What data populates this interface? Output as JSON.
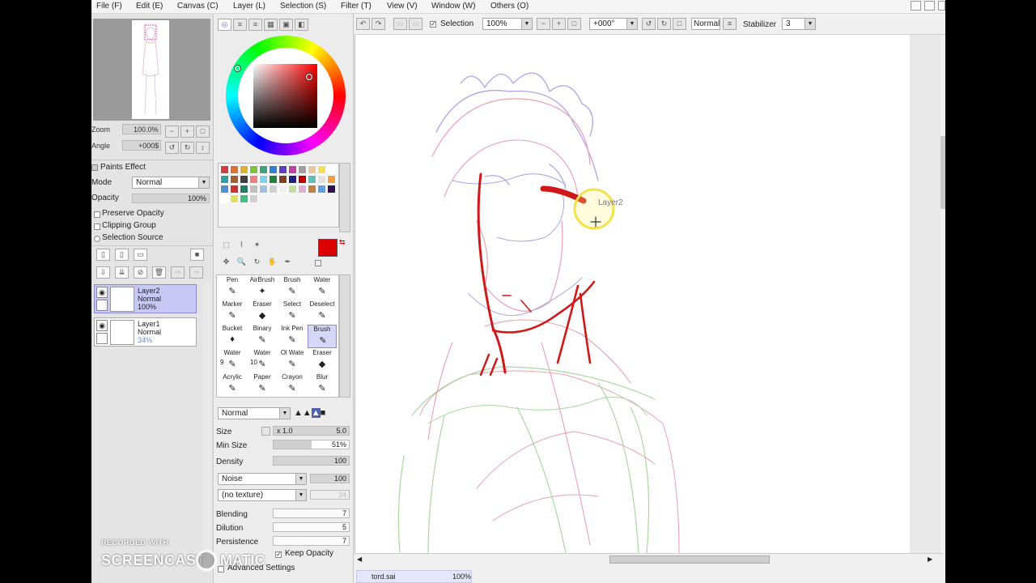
{
  "menubar": {
    "items": [
      "File (F)",
      "Edit (E)",
      "Canvas (C)",
      "Layer (L)",
      "Selection (S)",
      "Filter (T)",
      "View (V)",
      "Window (W)",
      "Others (O)"
    ]
  },
  "navigator": {
    "zoom_label": "Zoom",
    "zoom_value": "100.0%",
    "angle_label": "Angle",
    "angle_value": "+000$"
  },
  "layer_panel": {
    "paints_effect_label": "Paints Effect",
    "mode_label": "Mode",
    "mode_value": "Normal",
    "opacity_label": "Opacity",
    "opacity_value": "100%",
    "preserve_opacity_label": "Preserve Opacity",
    "clipping_group_label": "Clipping Group",
    "selection_source_label": "Selection Source",
    "layers": [
      {
        "name": "Layer2",
        "mode": "Normal",
        "opacity": "100%",
        "selected": true
      },
      {
        "name": "Layer1",
        "mode": "Normal",
        "opacity": "34%",
        "selected": false
      }
    ]
  },
  "colors": {
    "primary_color": "#dd0000",
    "secondary_color": "#ffffff",
    "palette": [
      "#d04040",
      "#e07030",
      "#e0b030",
      "#80c040",
      "#40a080",
      "#3080d0",
      "#6040c0",
      "#c040a0",
      "#a0a0a0",
      "#e8c8a0",
      "#f0e060",
      "#ffffff",
      "#30a0a0",
      "#a06030",
      "#404040",
      "#f08080",
      "#80d0f0",
      "#208040",
      "#804020",
      "#202080",
      "#c00000",
      "#60c0c0",
      "#e0e0e0",
      "#f0a040",
      "#5090d0",
      "#d03030",
      "#208060",
      "#c0c0c0",
      "#a0c0e0",
      "#d0d0d0",
      "#f0f0f0",
      "#c0e0a0",
      "#e0b0d0",
      "#c08040",
      "#60a0e0",
      "#301050",
      "#ffffff",
      "#e0e060",
      "#40c080",
      "#d0d0d0"
    ]
  },
  "tools": {
    "items": [
      {
        "label": "Pen",
        "glyph": "✎",
        "num": ""
      },
      {
        "label": "AirBrush",
        "glyph": "✦",
        "num": ""
      },
      {
        "label": "Brush",
        "glyph": "✎",
        "num": ""
      },
      {
        "label": "Water",
        "glyph": "✎",
        "num": ""
      },
      {
        "label": "Marker",
        "glyph": "✎",
        "num": ""
      },
      {
        "label": "Eraser",
        "glyph": "◆",
        "num": ""
      },
      {
        "label": "Select",
        "glyph": "✎",
        "num": ""
      },
      {
        "label": "Deselect",
        "glyph": "✎",
        "num": ""
      },
      {
        "label": "Bucket",
        "glyph": "♦",
        "num": ""
      },
      {
        "label": "Binary",
        "glyph": "✎",
        "num": ""
      },
      {
        "label": "Ink Pen",
        "glyph": "✎",
        "num": ""
      },
      {
        "label": "Brush",
        "glyph": "✎",
        "num": ""
      },
      {
        "label": "Water",
        "glyph": "✎",
        "num": "9"
      },
      {
        "label": "Water",
        "glyph": "✎",
        "num": "10"
      },
      {
        "label": "Ol Wate",
        "glyph": "✎",
        "num": ""
      },
      {
        "label": "Eraser",
        "glyph": "◆",
        "num": ""
      },
      {
        "label": "Acrylic",
        "glyph": "✎",
        "num": ""
      },
      {
        "label": "Paper",
        "glyph": "✎",
        "num": ""
      },
      {
        "label": "Crayon",
        "glyph": "✎",
        "num": ""
      },
      {
        "label": "Blur",
        "glyph": "✎",
        "num": ""
      }
    ],
    "selected_index": 11
  },
  "brush_settings": {
    "blend_mode": "Normal",
    "size_label": "Size",
    "size_multiplier": "x 1.0",
    "size_value": "5.0",
    "min_size_label": "Min Size",
    "min_size_value": "51%",
    "min_size_fraction": 0.51,
    "density_label": "Density",
    "density_value": "100",
    "noise_label": "Noise",
    "noise_value": "100",
    "texture_label": "(no texture)",
    "texture_value": "34",
    "blending_label": "Blending",
    "blending_value": "7",
    "dilution_label": "Dilution",
    "dilution_value": "5",
    "persistence_label": "Persistence",
    "persistence_value": "7",
    "keep_opacity_label": "Keep Opacity",
    "advanced_settings_label": "Advanced Settings"
  },
  "toolbar": {
    "selection_label": "Selection",
    "zoom_value": "100%",
    "rotation_value": "+000°",
    "blend_mode": "Normal",
    "stabilizer_label": "Stabilizer",
    "stabilizer_value": "3"
  },
  "canvas": {
    "cursor_layer_label": "Layer2"
  },
  "statusbar": {
    "doc_name": "tord.sai",
    "doc_zoom": "100%"
  },
  "watermark": {
    "top_text": "RECORDED WITH",
    "main_text": "SCREENCAST",
    "tail_text": "MATIC"
  }
}
